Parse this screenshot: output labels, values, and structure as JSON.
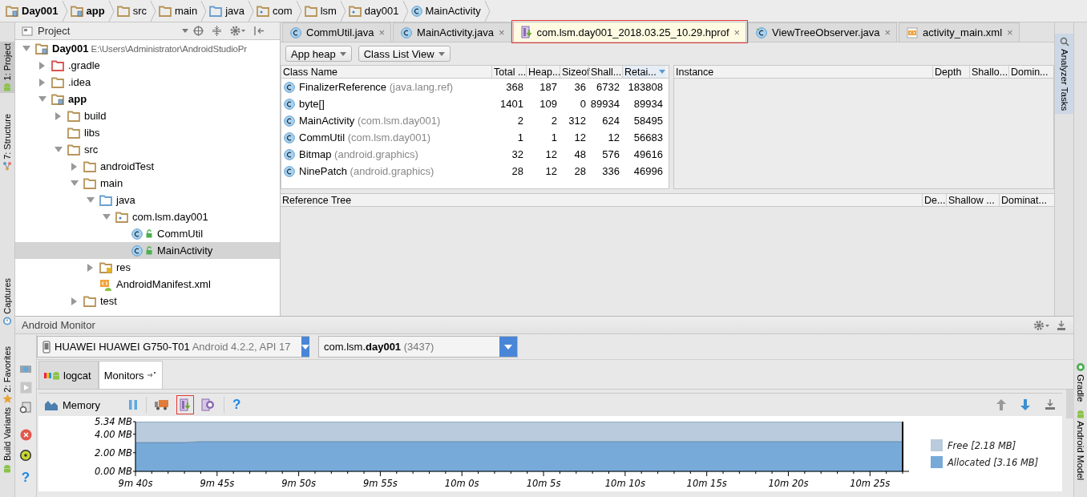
{
  "breadcrumbs": [
    {
      "label": "Day001",
      "kind": "module"
    },
    {
      "label": "app",
      "kind": "module"
    },
    {
      "label": "src",
      "kind": "folder"
    },
    {
      "label": "main",
      "kind": "folder"
    },
    {
      "label": "java",
      "kind": "source"
    },
    {
      "label": "com",
      "kind": "package"
    },
    {
      "label": "lsm",
      "kind": "folder"
    },
    {
      "label": "day001",
      "kind": "package"
    },
    {
      "label": "MainActivity",
      "kind": "class"
    }
  ],
  "left_toolstrip": [
    {
      "label": "1: Project",
      "selected": true,
      "kind": "android"
    },
    {
      "label": "7: Structure",
      "selected": false,
      "kind": "structure"
    },
    {
      "label": "Captures",
      "selected": false,
      "kind": "captures"
    },
    {
      "label": "2: Favorites",
      "selected": false,
      "kind": "star"
    },
    {
      "label": "Build Variants",
      "selected": false,
      "kind": "android"
    }
  ],
  "right_toolstrip": [
    {
      "label": "Gradle",
      "kind": "gradle"
    },
    {
      "label": "Android Model",
      "kind": "android"
    }
  ],
  "project_panel": {
    "title": "Project",
    "tree": [
      {
        "label": "Day001",
        "path": "E:\\Users\\Administrator\\AndroidStudioPr",
        "kind": "module",
        "expanded": true,
        "selected": false,
        "children": [
          {
            "label": ".gradle",
            "kind": "excluded",
            "expanded": false,
            "selected": false
          },
          {
            "label": ".idea",
            "kind": "folder",
            "expanded": false,
            "selected": false
          },
          {
            "label": "app",
            "kind": "module",
            "expanded": true,
            "selected": false,
            "children": [
              {
                "label": "build",
                "kind": "folder",
                "expanded": false,
                "selected": false
              },
              {
                "label": "libs",
                "kind": "folder",
                "selected": false
              },
              {
                "label": "src",
                "kind": "folder",
                "expanded": true,
                "selected": false,
                "children": [
                  {
                    "label": "androidTest",
                    "kind": "folder",
                    "expanded": false,
                    "selected": false
                  },
                  {
                    "label": "main",
                    "kind": "folder",
                    "expanded": true,
                    "selected": false,
                    "children": [
                      {
                        "label": "java",
                        "kind": "source",
                        "expanded": true,
                        "selected": false,
                        "children": [
                          {
                            "label": "com.lsm.day001",
                            "kind": "package",
                            "expanded": true,
                            "selected": false,
                            "children": [
                              {
                                "label": "CommUtil",
                                "kind": "class",
                                "selected": false
                              },
                              {
                                "label": "MainActivity",
                                "kind": "class",
                                "selected": true
                              }
                            ]
                          }
                        ]
                      },
                      {
                        "label": "res",
                        "kind": "res",
                        "expanded": false,
                        "selected": false
                      },
                      {
                        "label": "AndroidManifest.xml",
                        "kind": "manifest",
                        "selected": false
                      }
                    ]
                  },
                  {
                    "label": "test",
                    "kind": "folder",
                    "expanded": false,
                    "selected": false
                  }
                ]
              }
            ]
          }
        ]
      }
    ]
  },
  "editor": {
    "tabs": [
      {
        "label": "CommUtil.java",
        "kind": "class",
        "close": "×",
        "selected": false,
        "highlighted": false
      },
      {
        "label": "MainActivity.java",
        "kind": "class",
        "close": "×",
        "selected": false,
        "highlighted": false
      },
      {
        "label": "com.lsm.day001_2018.03.25_10.29.hprof",
        "kind": "hprof",
        "close": "×",
        "selected": true,
        "highlighted": true
      },
      {
        "label": "ViewTreeObserver.java",
        "kind": "interface",
        "close": "×",
        "selected": false,
        "highlighted": false
      },
      {
        "label": "activity_main.xml",
        "kind": "xml",
        "close": "×",
        "selected": false,
        "highlighted": false
      }
    ],
    "heap_selector": "App heap",
    "view_selector": "Class List View",
    "class_table": {
      "columns": [
        {
          "label": "Class Name",
          "sorted": false
        },
        {
          "label": "Total ...",
          "sorted": false
        },
        {
          "label": "Heap...",
          "sorted": false
        },
        {
          "label": "Sizeof",
          "sorted": false
        },
        {
          "label": "Shall...",
          "sorted": false
        },
        {
          "label": "Retai...",
          "sorted": true
        }
      ],
      "rows": [
        {
          "name": "FinalizerReference",
          "package": "(java.lang.ref)",
          "values": [
            "368",
            "187",
            "36",
            "6732",
            "183808"
          ]
        },
        {
          "name": "byte[]",
          "package": "",
          "values": [
            "1401",
            "109",
            "0",
            "89934",
            "89934"
          ]
        },
        {
          "name": "MainActivity",
          "package": "(com.lsm.day001)",
          "values": [
            "2",
            "2",
            "312",
            "624",
            "58495"
          ]
        },
        {
          "name": "CommUtil",
          "package": "(com.lsm.day001)",
          "values": [
            "1",
            "1",
            "12",
            "12",
            "56683"
          ]
        },
        {
          "name": "Bitmap",
          "package": "(android.graphics)",
          "values": [
            "32",
            "12",
            "48",
            "576",
            "49616"
          ]
        },
        {
          "name": "NinePatch",
          "package": "(android.graphics)",
          "values": [
            "28",
            "12",
            "28",
            "336",
            "46996"
          ]
        }
      ]
    },
    "instance_table": {
      "columns": [
        "Instance",
        "Depth",
        "Shallo...",
        "Domin..."
      ]
    },
    "reference_tree": {
      "columns": [
        "Reference Tree",
        "De...",
        "Shallow ...",
        "Dominat..."
      ]
    },
    "side_tab": {
      "label": "Analyzer Tasks",
      "selected": true
    }
  },
  "monitor": {
    "title": "Android Monitor",
    "device": {
      "name": "HUAWEI HUAWEI G750-T01",
      "detail": "Android 4.2.2, API 17"
    },
    "process": {
      "name": "com.lsm.**day001**",
      "detail": "(3437)"
    },
    "tabs": [
      {
        "label": "logcat",
        "kind": "logcat",
        "selected": false
      },
      {
        "label": "Monitors",
        "kind": "monitors",
        "selected": true
      }
    ],
    "memory": {
      "title": "Memory",
      "help": "?",
      "dump_highlighted": true,
      "chart_data": {
        "type": "area",
        "stacked": true,
        "categories": [
          "9m 40s",
          null,
          null,
          null,
          null,
          "9m 45s",
          null,
          null,
          null,
          null,
          "9m 50s",
          null,
          null,
          null,
          null,
          "9m 55s",
          null,
          null,
          null,
          null,
          "10m 0s",
          null,
          null,
          null,
          null,
          "10m 5s",
          null,
          null,
          null,
          null,
          "10m 10s",
          null,
          null,
          null,
          null,
          "10m 15s",
          null,
          null,
          null,
          null,
          "10m 20s",
          null,
          null,
          null,
          null,
          "10m 25s",
          null,
          null
        ],
        "series": [
          {
            "name": "Free [2.18 MB]",
            "color": "#b9cbdc",
            "values": [
              2.2,
              2.2,
              2.2,
              2.2,
              2.1,
              2.1,
              2.1,
              2.1,
              2.1,
              2.1,
              2.1,
              2.1,
              2.1,
              2.1,
              2.1,
              2.1,
              2.1,
              2.1,
              2.1,
              2.1,
              2.1,
              2.1,
              2.1,
              2.1,
              2.1,
              2.1,
              2.1,
              2.1,
              2.1,
              2.1,
              2.1,
              2.1,
              2.1,
              2.1,
              2.1,
              2.1,
              2.1,
              2.1,
              2.1,
              2.1,
              2.1,
              2.1,
              2.1,
              2.1,
              2.1,
              2.1,
              2.1,
              2.1
            ]
          },
          {
            "name": "Allocated [3.16 MB]",
            "color": "#77aad9",
            "values": [
              3.1,
              3.1,
              3.1,
              3.1,
              3.2,
              3.2,
              3.2,
              3.2,
              3.2,
              3.2,
              3.2,
              3.2,
              3.2,
              3.2,
              3.2,
              3.2,
              3.2,
              3.2,
              3.2,
              3.2,
              3.2,
              3.2,
              3.2,
              3.2,
              3.2,
              3.2,
              3.2,
              3.2,
              3.2,
              3.2,
              3.2,
              3.2,
              3.2,
              3.2,
              3.2,
              3.2,
              3.2,
              3.2,
              3.2,
              3.2,
              3.2,
              3.2,
              3.2,
              3.2,
              3.2,
              3.2,
              3.2,
              3.2
            ]
          }
        ],
        "ylim": [
          0,
          5.34
        ],
        "yticks": [
          {
            "value": 0,
            "label": "0.00 MB"
          },
          {
            "value": 2,
            "label": "2.00 MB"
          },
          {
            "value": 4,
            "label": "4.00 MB"
          },
          {
            "value": 5.34,
            "label": "5.34 MB"
          }
        ]
      }
    }
  }
}
